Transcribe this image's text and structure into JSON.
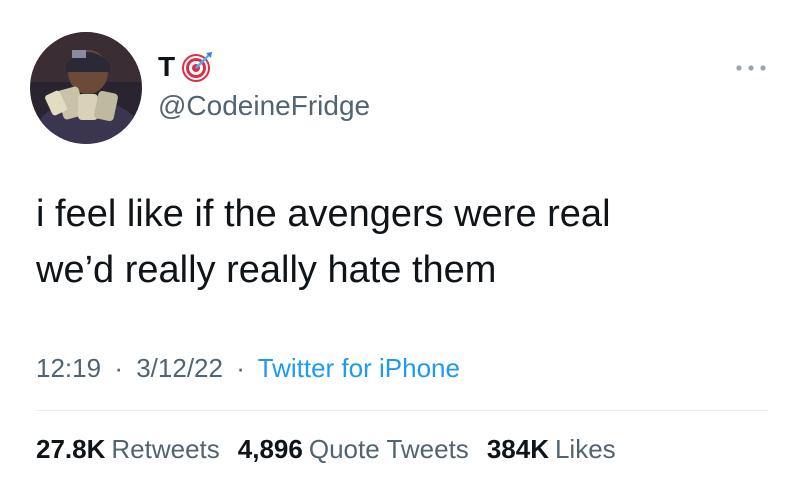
{
  "user": {
    "display_name": "T",
    "name_emoji_icon": "direct-hit-target-icon",
    "handle": "@CodeineFridge"
  },
  "tweet": {
    "line1": "i feel like if the avengers were real",
    "line2": "we’d really really hate them"
  },
  "meta": {
    "time": "12:19",
    "date": "3/12/22",
    "separator": "·",
    "source": "Twitter for iPhone"
  },
  "stats": [
    {
      "value": "27.8K",
      "label": "Retweets"
    },
    {
      "value": "4,896",
      "label": "Quote Tweets"
    },
    {
      "value": "384K",
      "label": "Likes"
    }
  ],
  "colors": {
    "text": "#0f1419",
    "secondary": "#536471",
    "link": "#1d9bf0",
    "divider": "#e6ecf0"
  },
  "icons": {
    "more": "more-horizontal-icon",
    "avatar": "profile-avatar"
  }
}
